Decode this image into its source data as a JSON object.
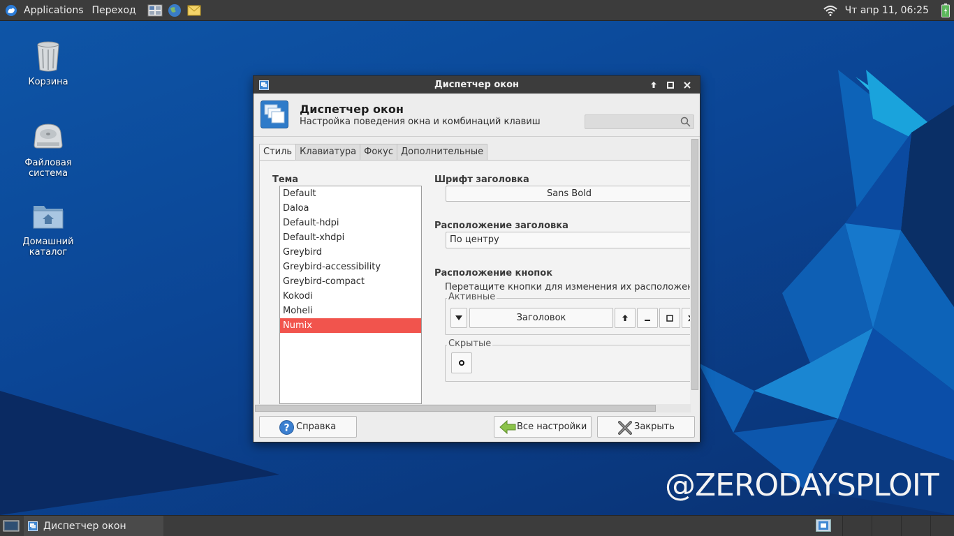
{
  "top_panel": {
    "menu_applications": "Applications",
    "menu_goto": "Переход",
    "launchers": [
      "workspace-switcher-icon",
      "web-browser-icon",
      "mail-icon"
    ],
    "clock": "Чт апр 11, 06:25"
  },
  "desktop_icons": [
    {
      "label": "Корзина",
      "icon": "trash-icon"
    },
    {
      "label": "Файловая\nсистема",
      "label_line1": "Файловая",
      "label_line2": "система",
      "icon": "drive-icon"
    },
    {
      "label_line1": "Домашний",
      "label_line2": "каталог",
      "icon": "home-folder-icon"
    }
  ],
  "window": {
    "title": "Диспетчер окон",
    "header_title": "Диспетчер окон",
    "header_subtitle": "Настройка поведения окна и комбинаций клавиш",
    "search_placeholder": "",
    "tabs": [
      {
        "label": "Стиль",
        "active": true
      },
      {
        "label": "Клавиатура",
        "active": false
      },
      {
        "label": "Фокус",
        "active": false
      },
      {
        "label": "Дополнительные",
        "active": false
      }
    ],
    "theme_label": "Тема",
    "themes": [
      "Default",
      "Daloa",
      "Default-hdpi",
      "Default-xhdpi",
      "Greybird",
      "Greybird-accessibility",
      "Greybird-compact",
      "Kokodi",
      "Moheli",
      "Numix"
    ],
    "selected_theme": "Numix",
    "title_font_label": "Шрифт заголовка",
    "title_font_value": "Sans Bold",
    "title_align_label": "Расположение заголовка",
    "title_align_value": "По центру",
    "buttons_layout_label": "Расположение кнопок",
    "buttons_layout_hint": "Перетащите кнопки для изменения их расположен",
    "active_label": "Активные",
    "active_title_button": "Заголовок",
    "hidden_label": "Скрытые",
    "help_button": "Справка",
    "all_settings_button": "Все настройки",
    "close_button": "Закрыть"
  },
  "taskbar": {
    "task_label": "Диспетчер окон"
  },
  "watermark": "@ZERODAYSPLOIT",
  "colors": {
    "selection": "#f1544d",
    "panel": "#3c3c3c",
    "desktop": "#0b4595"
  }
}
